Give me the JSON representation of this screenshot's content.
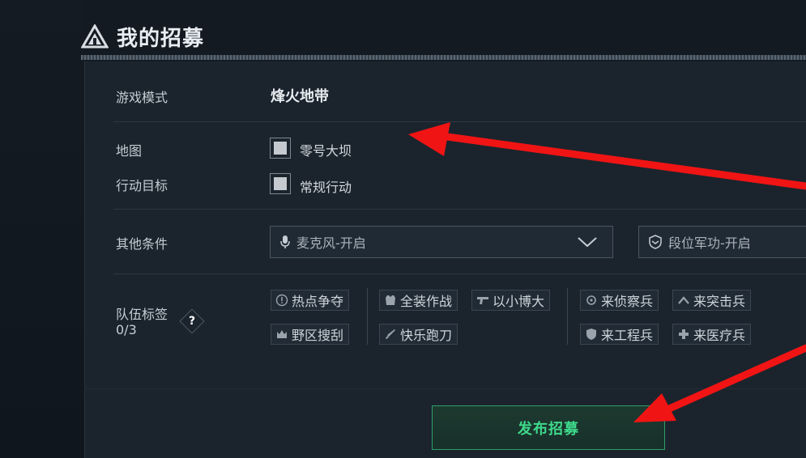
{
  "header": {
    "title": "我的招募"
  },
  "form": {
    "mode_label": "游戏模式",
    "mode_value": "烽火地带",
    "map_label": "地图",
    "map_option": "零号大坝",
    "objective_label": "行动目标",
    "objective_option": "常规行动",
    "conditions_label": "其他条件",
    "mic_select": "麦克风-开启",
    "rank_select": "段位军功-开启",
    "tags_label": "队伍标签",
    "tags_count": "0/3",
    "help_symbol": "?"
  },
  "tags": {
    "hotspot": "热点争夺",
    "wild": "野区搜刮",
    "fullgear": "全装作战",
    "happy_knife": "快乐跑刀",
    "underdog": "以小博大",
    "recon": "来侦察兵",
    "assault": "来突击兵",
    "engineer": "来工程兵",
    "medic": "来医疗兵"
  },
  "actions": {
    "publish": "发布招募"
  },
  "colors": {
    "accent_green": "#3ed98b",
    "annotation_red": "#f01414"
  }
}
